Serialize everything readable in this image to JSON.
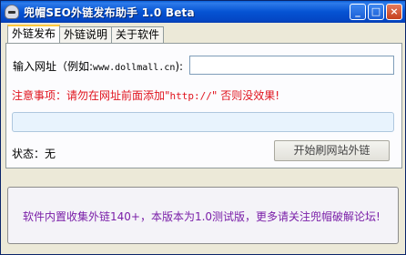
{
  "window": {
    "title": "兜帽SEO外链发布助手 1.0 Beta",
    "buttons": {
      "minimize": "_",
      "maximize": "□",
      "close": "×"
    }
  },
  "tabs": [
    {
      "label": "外链发布",
      "active": true
    },
    {
      "label": "外链说明",
      "active": false
    },
    {
      "label": "关于软件",
      "active": false
    }
  ],
  "form": {
    "url_label_prefix": "输入网址（例如:",
    "url_label_example": "www.dollmall.cn",
    "url_label_suffix": "):",
    "url_value": "",
    "notice_prefix": "注意事项：请勿在网址前面添加\"",
    "notice_code": "http://",
    "notice_suffix": "\" 否则没效果!",
    "progress": 0,
    "status_label": "状态：",
    "status_value": "无",
    "start_button": "开始刷网站外链"
  },
  "info": {
    "text": "软件内置收集外链140+，本版本为1.0测试版，更多请关注兜帽破解论坛!"
  },
  "colors": {
    "notice": "#E0141E",
    "info_text": "#7A1FA8",
    "titlebar": "#0553D3"
  }
}
